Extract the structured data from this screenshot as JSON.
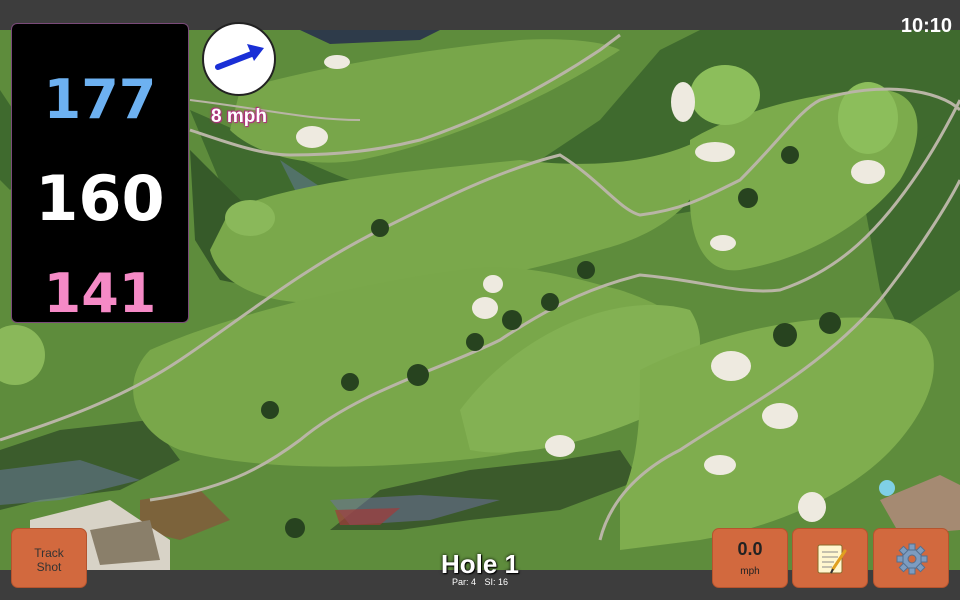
{
  "status_bar": {
    "clock": "10:10"
  },
  "distances": {
    "back": "177",
    "middle": "160",
    "front": "141"
  },
  "wind": {
    "speed": "8 mph",
    "icon": "wind-direction-arrow-icon"
  },
  "buttons": {
    "track_shot": {
      "line1": "Track",
      "line2": "Shot"
    },
    "speed": {
      "value": "0.0",
      "unit": "mph"
    },
    "notes_icon": "notepad-icon",
    "settings_icon": "gear-icon"
  },
  "hole": {
    "title": "Hole 1",
    "par": "Par: 4",
    "si": "SI: 16"
  },
  "colors": {
    "back": "#6db1f1",
    "middle": "#ffffff",
    "front": "#f58ac6",
    "button": "#d2693e",
    "wind_accent": "#b0307e"
  }
}
